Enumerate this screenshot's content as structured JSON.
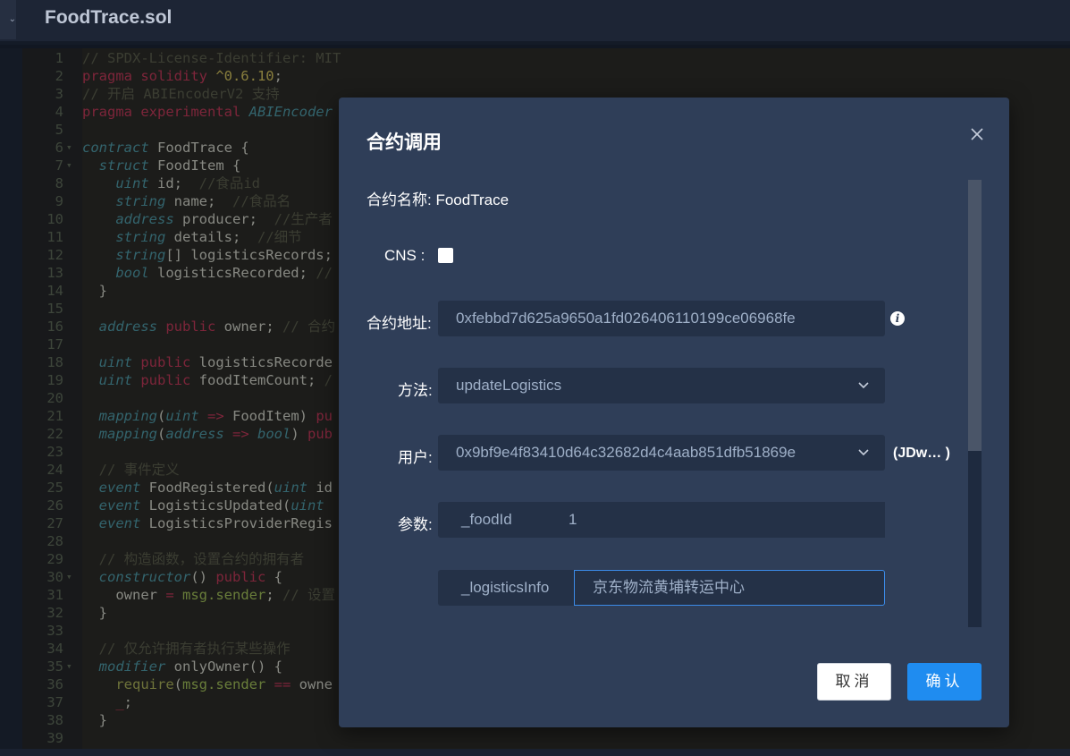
{
  "editor": {
    "file_name": "FoodTrace.sol",
    "lines": [
      {
        "n": "1",
        "fold": "",
        "segs": [
          [
            "c",
            "// SPDX-License-Identifier: MIT"
          ]
        ]
      },
      {
        "n": "2",
        "fold": "",
        "segs": [
          [
            "k",
            "pragma solidity "
          ],
          [
            "s",
            "^0.6.10"
          ],
          [
            "p",
            ";"
          ]
        ]
      },
      {
        "n": "3",
        "fold": "",
        "segs": [
          [
            "c",
            "// 开启 ABIEncoderV2 支持"
          ]
        ]
      },
      {
        "n": "4",
        "fold": "",
        "segs": [
          [
            "k",
            "pragma experimental "
          ],
          [
            "t",
            "ABIEncoder"
          ]
        ]
      },
      {
        "n": "5",
        "fold": "",
        "segs": []
      },
      {
        "n": "6",
        "fold": "▾",
        "segs": [
          [
            "t",
            "contract "
          ],
          [
            "v",
            "FoodTrace {"
          ]
        ]
      },
      {
        "n": "7",
        "fold": "▾",
        "segs": [
          [
            "p",
            "  "
          ],
          [
            "t",
            "struct "
          ],
          [
            "v",
            "FoodItem {"
          ]
        ]
      },
      {
        "n": "8",
        "fold": "",
        "segs": [
          [
            "p",
            "    "
          ],
          [
            "t",
            "uint "
          ],
          [
            "v",
            "id;  "
          ],
          [
            "c",
            "//食品id"
          ]
        ]
      },
      {
        "n": "9",
        "fold": "",
        "segs": [
          [
            "p",
            "    "
          ],
          [
            "t",
            "string "
          ],
          [
            "v",
            "name;  "
          ],
          [
            "c",
            "//食品名"
          ]
        ]
      },
      {
        "n": "10",
        "fold": "",
        "segs": [
          [
            "p",
            "    "
          ],
          [
            "t",
            "address "
          ],
          [
            "v",
            "producer;  "
          ],
          [
            "c",
            "//生产者"
          ]
        ]
      },
      {
        "n": "11",
        "fold": "",
        "segs": [
          [
            "p",
            "    "
          ],
          [
            "t",
            "string "
          ],
          [
            "v",
            "details;  "
          ],
          [
            "c",
            "//细节"
          ]
        ]
      },
      {
        "n": "12",
        "fold": "",
        "segs": [
          [
            "p",
            "    "
          ],
          [
            "t",
            "string"
          ],
          [
            "v",
            "[] logisticsRecords;"
          ]
        ]
      },
      {
        "n": "13",
        "fold": "",
        "segs": [
          [
            "p",
            "    "
          ],
          [
            "t",
            "bool "
          ],
          [
            "v",
            "logisticsRecorded; "
          ],
          [
            "c",
            "//"
          ]
        ]
      },
      {
        "n": "14",
        "fold": "",
        "segs": [
          [
            "p",
            "  }"
          ]
        ]
      },
      {
        "n": "15",
        "fold": "",
        "segs": []
      },
      {
        "n": "16",
        "fold": "",
        "segs": [
          [
            "p",
            "  "
          ],
          [
            "t",
            "address "
          ],
          [
            "k",
            "public "
          ],
          [
            "v",
            "owner; "
          ],
          [
            "c",
            "// 合约"
          ]
        ]
      },
      {
        "n": "17",
        "fold": "",
        "segs": []
      },
      {
        "n": "18",
        "fold": "",
        "segs": [
          [
            "p",
            "  "
          ],
          [
            "t",
            "uint "
          ],
          [
            "k",
            "public "
          ],
          [
            "v",
            "logisticsRecorde"
          ]
        ]
      },
      {
        "n": "19",
        "fold": "",
        "segs": [
          [
            "p",
            "  "
          ],
          [
            "t",
            "uint "
          ],
          [
            "k",
            "public "
          ],
          [
            "v",
            "foodItemCount; "
          ],
          [
            "c",
            "/"
          ]
        ]
      },
      {
        "n": "20",
        "fold": "",
        "segs": []
      },
      {
        "n": "21",
        "fold": "",
        "segs": [
          [
            "p",
            "  "
          ],
          [
            "t",
            "mapping"
          ],
          [
            "v",
            "("
          ],
          [
            "t",
            "uint "
          ],
          [
            "k",
            "=> "
          ],
          [
            "v",
            "FoodItem) "
          ],
          [
            "k",
            "pu"
          ]
        ]
      },
      {
        "n": "22",
        "fold": "",
        "segs": [
          [
            "p",
            "  "
          ],
          [
            "t",
            "mapping"
          ],
          [
            "v",
            "("
          ],
          [
            "t",
            "address "
          ],
          [
            "k",
            "=> "
          ],
          [
            "t",
            "bool"
          ],
          [
            "v",
            ") "
          ],
          [
            "k",
            "pub"
          ]
        ]
      },
      {
        "n": "23",
        "fold": "",
        "segs": []
      },
      {
        "n": "24",
        "fold": "",
        "segs": [
          [
            "p",
            "  "
          ],
          [
            "c",
            "// 事件定义"
          ]
        ]
      },
      {
        "n": "25",
        "fold": "",
        "segs": [
          [
            "p",
            "  "
          ],
          [
            "t",
            "event "
          ],
          [
            "v",
            "FoodRegistered("
          ],
          [
            "t",
            "uint "
          ],
          [
            "v",
            "id"
          ]
        ]
      },
      {
        "n": "26",
        "fold": "",
        "segs": [
          [
            "p",
            "  "
          ],
          [
            "t",
            "event "
          ],
          [
            "v",
            "LogisticsUpdated("
          ],
          [
            "t",
            "uint"
          ]
        ]
      },
      {
        "n": "27",
        "fold": "",
        "segs": [
          [
            "p",
            "  "
          ],
          [
            "t",
            "event "
          ],
          [
            "v",
            "LogisticsProviderRegis"
          ]
        ]
      },
      {
        "n": "28",
        "fold": "",
        "segs": []
      },
      {
        "n": "29",
        "fold": "",
        "segs": [
          [
            "p",
            "  "
          ],
          [
            "c",
            "// 构造函数，设置合约的拥有者"
          ]
        ]
      },
      {
        "n": "30",
        "fold": "▾",
        "segs": [
          [
            "p",
            "  "
          ],
          [
            "t",
            "constructor"
          ],
          [
            "v",
            "() "
          ],
          [
            "k",
            "public "
          ],
          [
            "v",
            "{"
          ]
        ]
      },
      {
        "n": "31",
        "fold": "",
        "segs": [
          [
            "p",
            "    "
          ],
          [
            "v",
            "owner "
          ],
          [
            "k",
            "= "
          ],
          [
            "g",
            "msg.sender"
          ],
          [
            "v",
            "; "
          ],
          [
            "c",
            "// 设置"
          ]
        ]
      },
      {
        "n": "32",
        "fold": "",
        "segs": [
          [
            "p",
            "  }"
          ]
        ]
      },
      {
        "n": "33",
        "fold": "",
        "segs": []
      },
      {
        "n": "34",
        "fold": "",
        "segs": [
          [
            "p",
            "  "
          ],
          [
            "c",
            "// 仅允许拥有者执行某些操作"
          ]
        ]
      },
      {
        "n": "35",
        "fold": "▾",
        "segs": [
          [
            "p",
            "  "
          ],
          [
            "t",
            "modifier "
          ],
          [
            "v",
            "onlyOwner() {"
          ]
        ]
      },
      {
        "n": "36",
        "fold": "",
        "segs": [
          [
            "p",
            "    "
          ],
          [
            "n",
            "require"
          ],
          [
            "v",
            "("
          ],
          [
            "g",
            "msg.sender "
          ],
          [
            "k",
            "== "
          ],
          [
            "v",
            "owne"
          ]
        ]
      },
      {
        "n": "37",
        "fold": "",
        "segs": [
          [
            "p",
            "    "
          ],
          [
            "k",
            "_"
          ],
          [
            "v",
            ";"
          ]
        ]
      },
      {
        "n": "38",
        "fold": "",
        "segs": [
          [
            "p",
            "  }"
          ]
        ]
      },
      {
        "n": "39",
        "fold": "",
        "segs": []
      }
    ]
  },
  "modal": {
    "title": "合约调用",
    "contract_name_label": "合约名称: FoodTrace",
    "cns_label": "CNS :",
    "address_label": "合约地址:",
    "address_value": "0xfebbd7d625a9650a1fd026406110199ce06968fe",
    "method_label": "方法:",
    "method_value": "updateLogistics",
    "user_label": "用户:",
    "user_value": "0x9bf9e4f83410d64c32682d4c4aab851dfb51869e",
    "user_alias": "(JDw… )",
    "params_label": "参数:",
    "param1_name": "_foodId",
    "param1_value": "1",
    "param2_name": "_logisticsInfo",
    "param2_value": "京东物流黄埔转运中心",
    "cancel_label": "取消",
    "confirm_label": "确认"
  },
  "icons": {
    "close": "close-icon",
    "info": "info-icon",
    "chevron": "chevron-down-icon"
  },
  "colors": {
    "modal_bg": "#2f3e58",
    "field_bg": "#243147",
    "primary": "#1f8cf0",
    "active_border": "#3b8be8"
  }
}
